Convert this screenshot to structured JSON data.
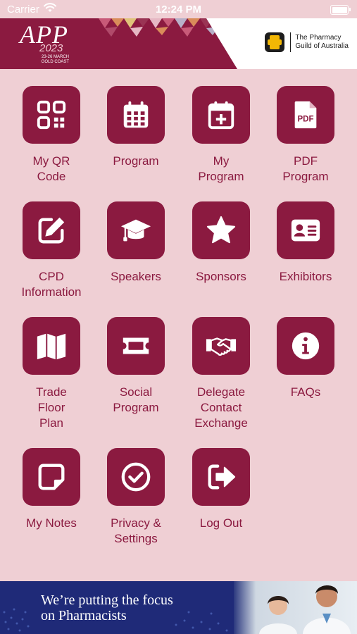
{
  "status_bar": {
    "carrier": "Carrier",
    "time": "12:24 PM"
  },
  "header": {
    "event_logo": {
      "name": "APP",
      "year": "2023",
      "dates": "23-26 MARCH",
      "location": "GOLD COAST"
    },
    "organisation": {
      "line1": "The Pharmacy",
      "line2": "Guild of Australia"
    }
  },
  "menu": {
    "items": [
      {
        "label": "My QR\nCode",
        "icon": "qr-code-icon"
      },
      {
        "label": "Program",
        "icon": "calendar-icon"
      },
      {
        "label": "My\nProgram",
        "icon": "calendar-add-icon"
      },
      {
        "label": "PDF\nProgram",
        "icon": "pdf-file-icon"
      },
      {
        "label": "CPD\nInformation",
        "icon": "edit-icon"
      },
      {
        "label": "Speakers",
        "icon": "graduation-cap-icon"
      },
      {
        "label": "Sponsors",
        "icon": "star-icon"
      },
      {
        "label": "Exhibitors",
        "icon": "id-card-icon"
      },
      {
        "label": "Trade\nFloor\nPlan",
        "icon": "map-icon"
      },
      {
        "label": "Social\nProgram",
        "icon": "ticket-icon"
      },
      {
        "label": "Delegate\nContact\nExchange",
        "icon": "handshake-icon"
      },
      {
        "label": "FAQs",
        "icon": "info-icon"
      },
      {
        "label": "My Notes",
        "icon": "sticky-note-icon"
      },
      {
        "label": "Privacy &\nSettings",
        "icon": "check-circle-icon"
      },
      {
        "label": "Log Out",
        "icon": "log-out-icon"
      }
    ]
  },
  "banner": {
    "line1": "We’re putting the focus",
    "line2": "on Pharmacists"
  },
  "colors": {
    "brand": "#8b1a40",
    "background": "#efcfd4",
    "banner": "#1f2a78"
  }
}
